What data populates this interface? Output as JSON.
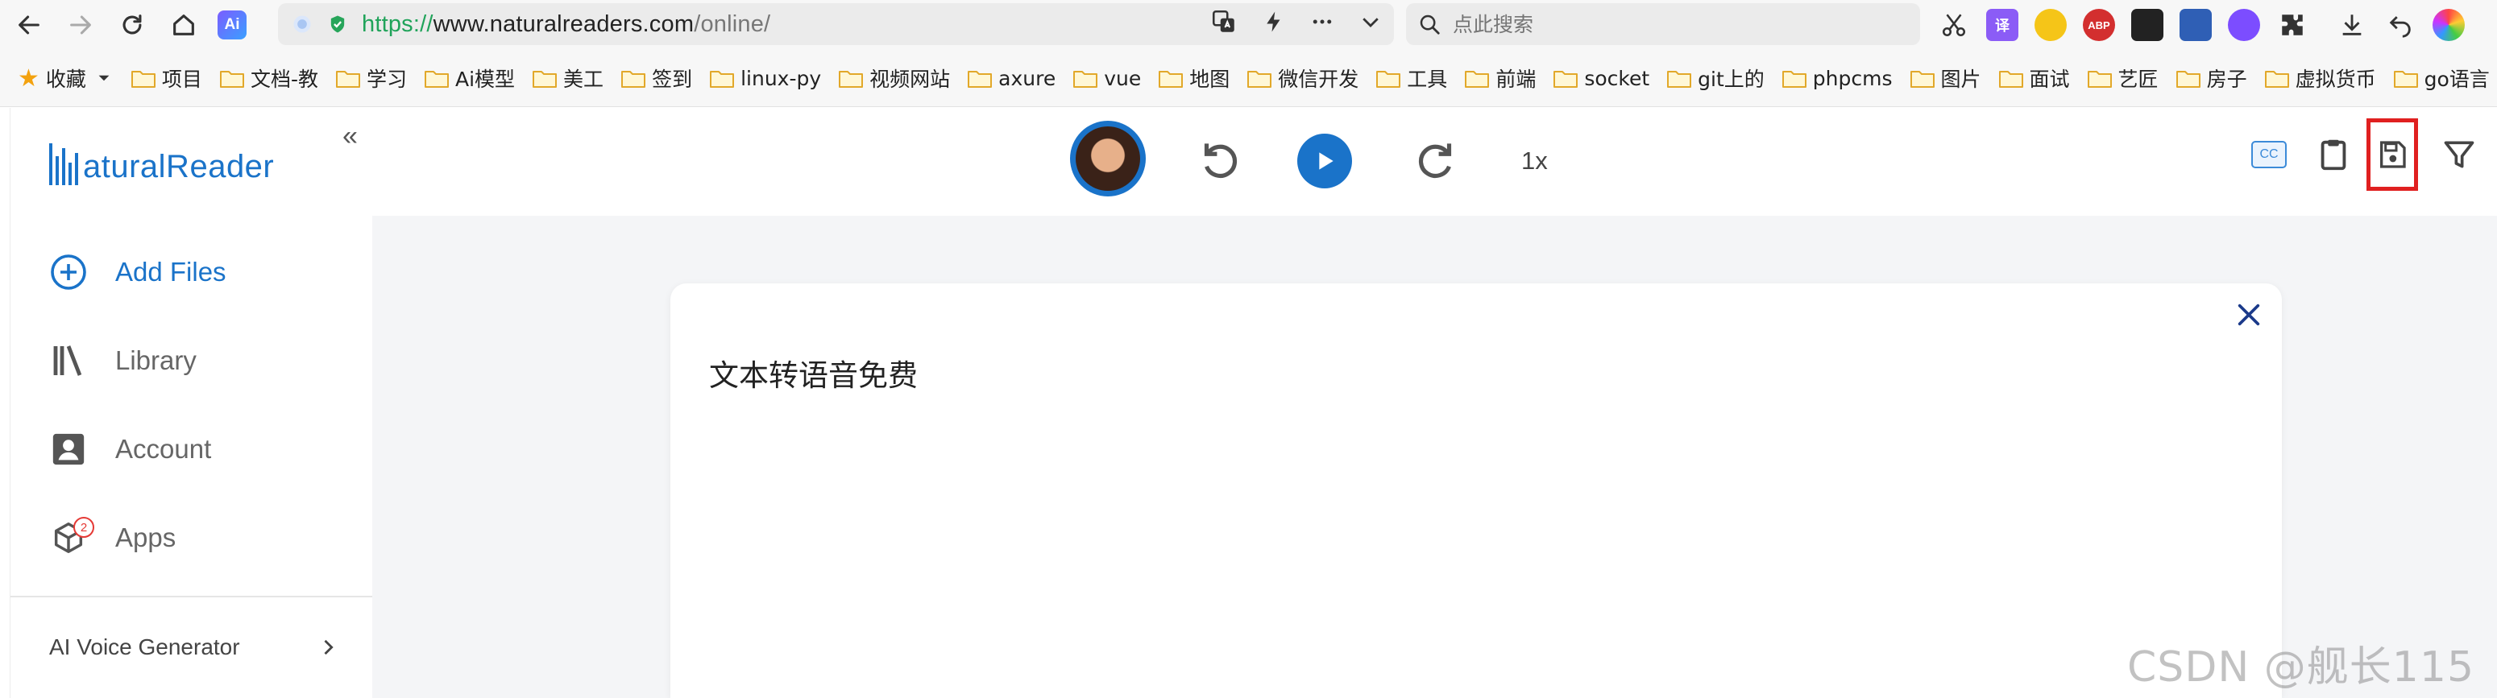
{
  "browser": {
    "url_scheme": "https://",
    "url_host": "www.naturalreaders.com",
    "url_path": "/online/",
    "ai_badge": "Ai",
    "search_placeholder": "点此搜索"
  },
  "bookmarks": {
    "favorites_label": "收藏",
    "items": [
      "项目",
      "文档-教",
      "学习",
      "Ai模型",
      "美工",
      "签到",
      "linux-py",
      "视频网站",
      "axure",
      "vue",
      "地图",
      "微信开发",
      "工具",
      "前端",
      "socket",
      "git上的",
      "phpcms",
      "图片",
      "面试",
      "艺匠",
      "房子",
      "虚拟货币",
      "go语言"
    ]
  },
  "extensions": {
    "translate": "译",
    "abp": "ABP"
  },
  "sidebar": {
    "logo_text": "aturalReader",
    "items": [
      {
        "label": "Add Files"
      },
      {
        "label": "Library"
      },
      {
        "label": "Account"
      },
      {
        "label": "Apps",
        "badge": "2"
      }
    ],
    "voice_generator": "AI Voice Generator"
  },
  "player": {
    "speed": "1x",
    "cc_label": "CC"
  },
  "document": {
    "text": "文本转语音免费"
  },
  "watermark": "CSDN @舰长115",
  "colors": {
    "brand_blue": "#1a73c9",
    "highlight_red": "#e02020"
  }
}
